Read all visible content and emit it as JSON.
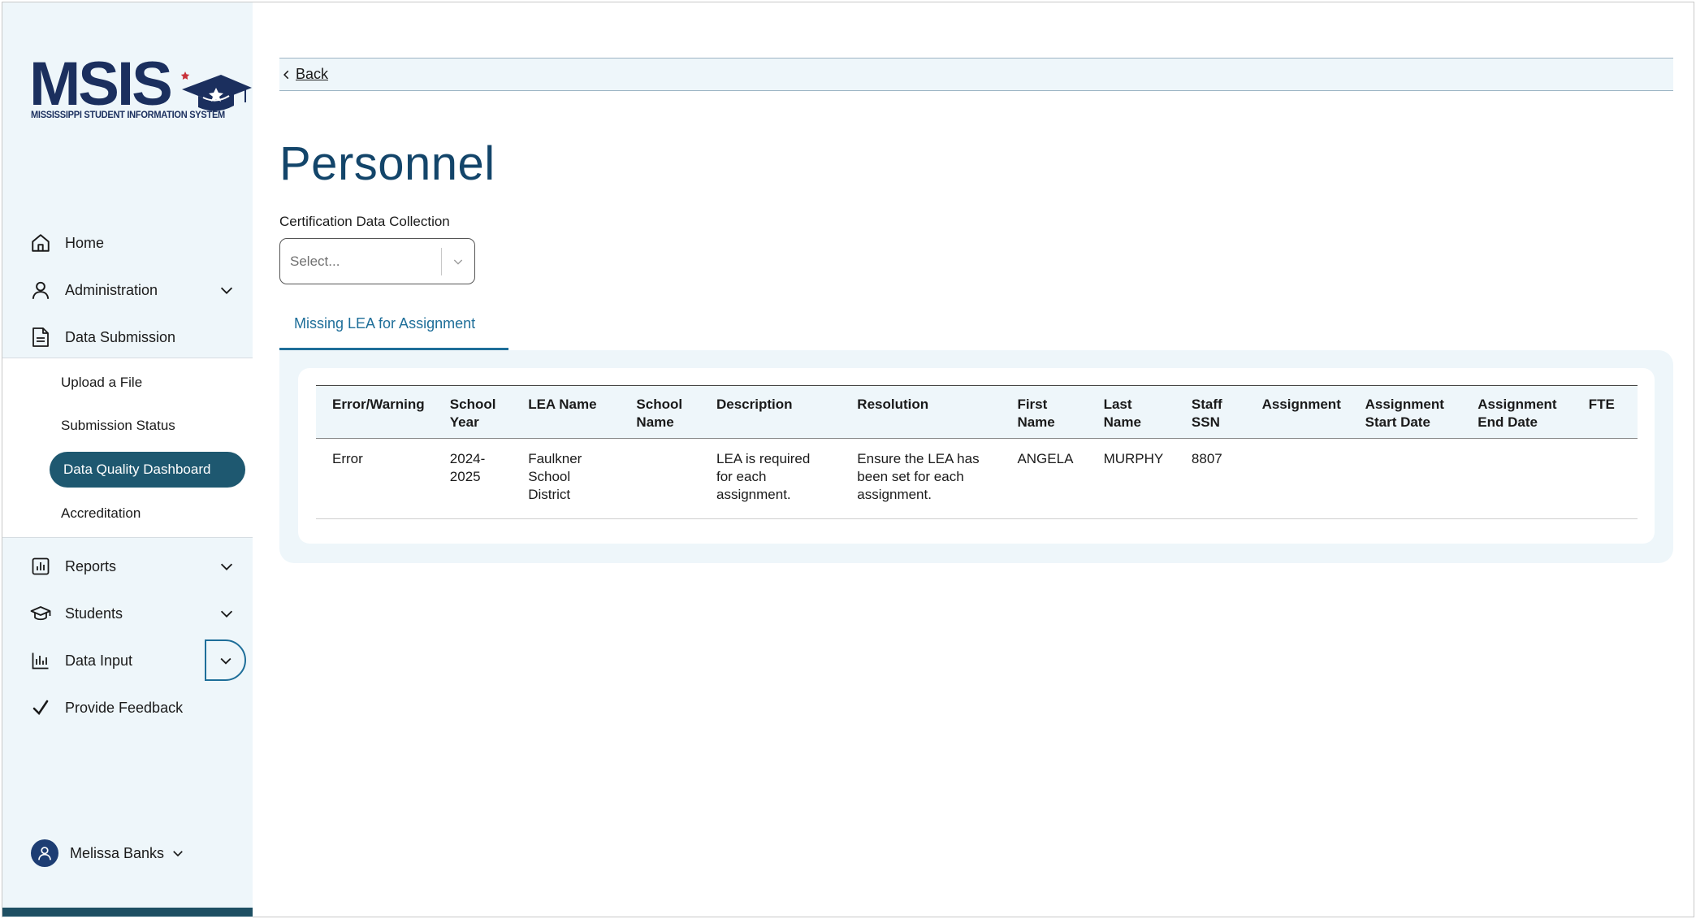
{
  "logo": {
    "name": "MSIS",
    "subtitle": "MISSISSIPPI STUDENT INFORMATION SYSTEM"
  },
  "nav": {
    "home": "Home",
    "administration": "Administration",
    "data_submission": "Data Submission",
    "submenu": {
      "upload": "Upload a File",
      "status": "Submission Status",
      "dashboard": "Data Quality Dashboard",
      "accreditation": "Accreditation"
    },
    "reports": "Reports",
    "students": "Students",
    "data_input": "Data Input",
    "feedback": "Provide Feedback"
  },
  "user": {
    "name": "Melissa Banks"
  },
  "main": {
    "back": "Back",
    "title": "Personnel",
    "collection_label": "Certification Data Collection",
    "collection_placeholder": "Select...",
    "tab": "Missing LEA for Assignment"
  },
  "table": {
    "headers": [
      [
        "Error/Warning"
      ],
      [
        "School",
        "Year"
      ],
      [
        "LEA Name"
      ],
      [
        "School",
        "Name"
      ],
      [
        "Description"
      ],
      [
        "Resolution"
      ],
      [
        "First",
        "Name"
      ],
      [
        "Last",
        "Name"
      ],
      [
        "Staff",
        "SSN"
      ],
      [
        "Assignment"
      ],
      [
        "Assignment",
        "Start Date"
      ],
      [
        "Assignment",
        "End Date"
      ],
      [
        "FTE"
      ]
    ],
    "rows": [
      [
        [
          "Error"
        ],
        [
          "2024-",
          "2025"
        ],
        [
          "Faulkner",
          "School",
          "District"
        ],
        [
          ""
        ],
        [
          "LEA is required",
          "for each",
          "assignment."
        ],
        [
          "Ensure the LEA has",
          "been set for each",
          "assignment."
        ],
        [
          "ANGELA"
        ],
        [
          "MURPHY"
        ],
        [
          "8807"
        ],
        [
          ""
        ],
        [
          ""
        ],
        [
          ""
        ],
        [
          ""
        ]
      ]
    ]
  },
  "colors": {
    "primary": "#13456a",
    "accent": "#1e6e99",
    "active_pill": "#1e5870",
    "sidebar_bg": "#eef6fa",
    "logo": "#1b2f5e"
  }
}
